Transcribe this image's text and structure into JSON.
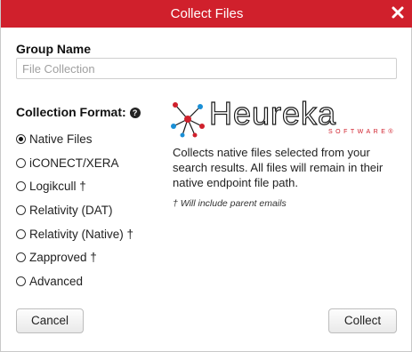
{
  "dialog": {
    "title": "Collect Files",
    "close_icon": "close-x-icon"
  },
  "group": {
    "label": "Group Name",
    "placeholder": "File Collection",
    "value": ""
  },
  "collection": {
    "label": "Collection Format:",
    "help_icon": "question-circle-icon",
    "help_glyph": "?",
    "selected": "Native Files",
    "options": [
      {
        "label": "Native Files",
        "checked": true
      },
      {
        "label": "iCONECT/XERA",
        "checked": false
      },
      {
        "label": "Logikcull †",
        "checked": false
      },
      {
        "label": "Relativity (DAT)",
        "checked": false
      },
      {
        "label": "Relativity (Native) †",
        "checked": false
      },
      {
        "label": "Zapproved †",
        "checked": false
      },
      {
        "label": "Advanced",
        "checked": false
      }
    ]
  },
  "logo": {
    "wordmark": "Heureka",
    "subword": "SOFTWARE®"
  },
  "description": {
    "text": "Collects native files selected from your search results. All files will remain in their native endpoint file path.",
    "footnote": "† Will include parent emails"
  },
  "buttons": {
    "cancel": "Cancel",
    "collect": "Collect"
  },
  "colors": {
    "titlebar": "#d0202c",
    "logo_accent": "#d0202c",
    "logo_nodes": "#1a8fd6"
  }
}
